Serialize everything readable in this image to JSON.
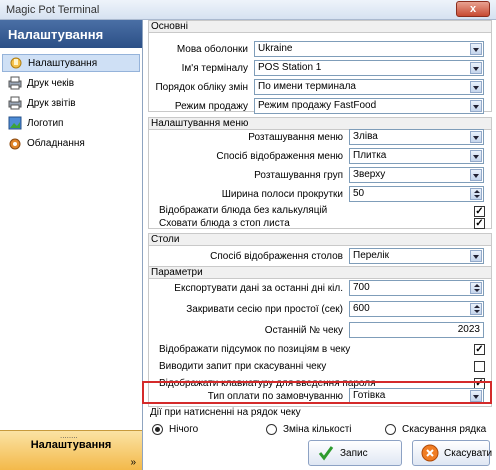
{
  "window": {
    "title": "Magic Pot Terminal",
    "close_label": "x"
  },
  "sidebar": {
    "header": "Налаштування",
    "items": [
      {
        "label": "Налаштування",
        "icon": "settings-hand-icon",
        "selected": true
      },
      {
        "label": "Друк чеків",
        "icon": "printer-icon",
        "selected": false
      },
      {
        "label": "Друк звітів",
        "icon": "printer-icon",
        "selected": false
      },
      {
        "label": "Логотип",
        "icon": "logo-image-icon",
        "selected": false
      },
      {
        "label": "Обладнання",
        "icon": "equipment-icon",
        "selected": false
      }
    ],
    "bottom_label": "Налаштування",
    "bottom_grip": "........",
    "bottom_chevron": "»"
  },
  "basic": {
    "title": "Основні",
    "lang_label": "Мова оболонки",
    "lang_value": "Ukraine",
    "term_label": "Ім'я терміналу",
    "term_value": "POS Station 1",
    "shift_label": "Порядок обліку змін",
    "shift_value": "По имени терминала",
    "mode_label": "Режим продажу",
    "mode_value": "Режим продажу FastFood"
  },
  "menu": {
    "title": "Налаштування меню",
    "pos_label": "Розташування меню",
    "pos_value": "Зліва",
    "disp_label": "Спосіб відображення меню",
    "disp_value": "Плитка",
    "grp_label": "Розташування груп",
    "grp_value": "Зверху",
    "scroll_label": "Ширина полоси прокрутки",
    "scroll_value": "50",
    "nocalc_label": "Відображати блюда без калькуляцій",
    "nocalc_checked": true,
    "hidestop_label": "Сховати блюда з стоп листа",
    "hidestop_checked": true
  },
  "tables": {
    "title": "Столи",
    "disp_label": "Спосіб відображення столов",
    "disp_value": "Перелік"
  },
  "params": {
    "title": "Параметри",
    "export_label": "Експортувати дані за останні дні кіл.",
    "export_value": "700",
    "idle_label": "Закривати сесію при простої (сек)",
    "idle_value": "600",
    "check_label": "Останній № чеку",
    "check_value": "2023",
    "showsum_label": "Відображати підсумок по позиціям в чеку",
    "showsum_checked": true,
    "cancelq_label": "Виводити запит при скасуванні чеку",
    "cancelq_checked": false,
    "kbd_label": "Відображати клавиатуру для введення пароля",
    "kbd_checked": true,
    "paytype_label": "Тип оплати по замовчуванню",
    "paytype_value": "Готівка"
  },
  "rowaction": {
    "title": "Дії при натисненні на рядок чеку",
    "options": [
      "Нічого",
      "Зміна кількості",
      "Скасування рядка"
    ],
    "selected": 0
  },
  "buttons": {
    "save": "Запис",
    "cancel": "Скасувати"
  },
  "colors": {
    "highlight": "#d42a2a",
    "sidebar_header": "#2b4f86",
    "sidebar_bottom": "#f3b94a"
  }
}
